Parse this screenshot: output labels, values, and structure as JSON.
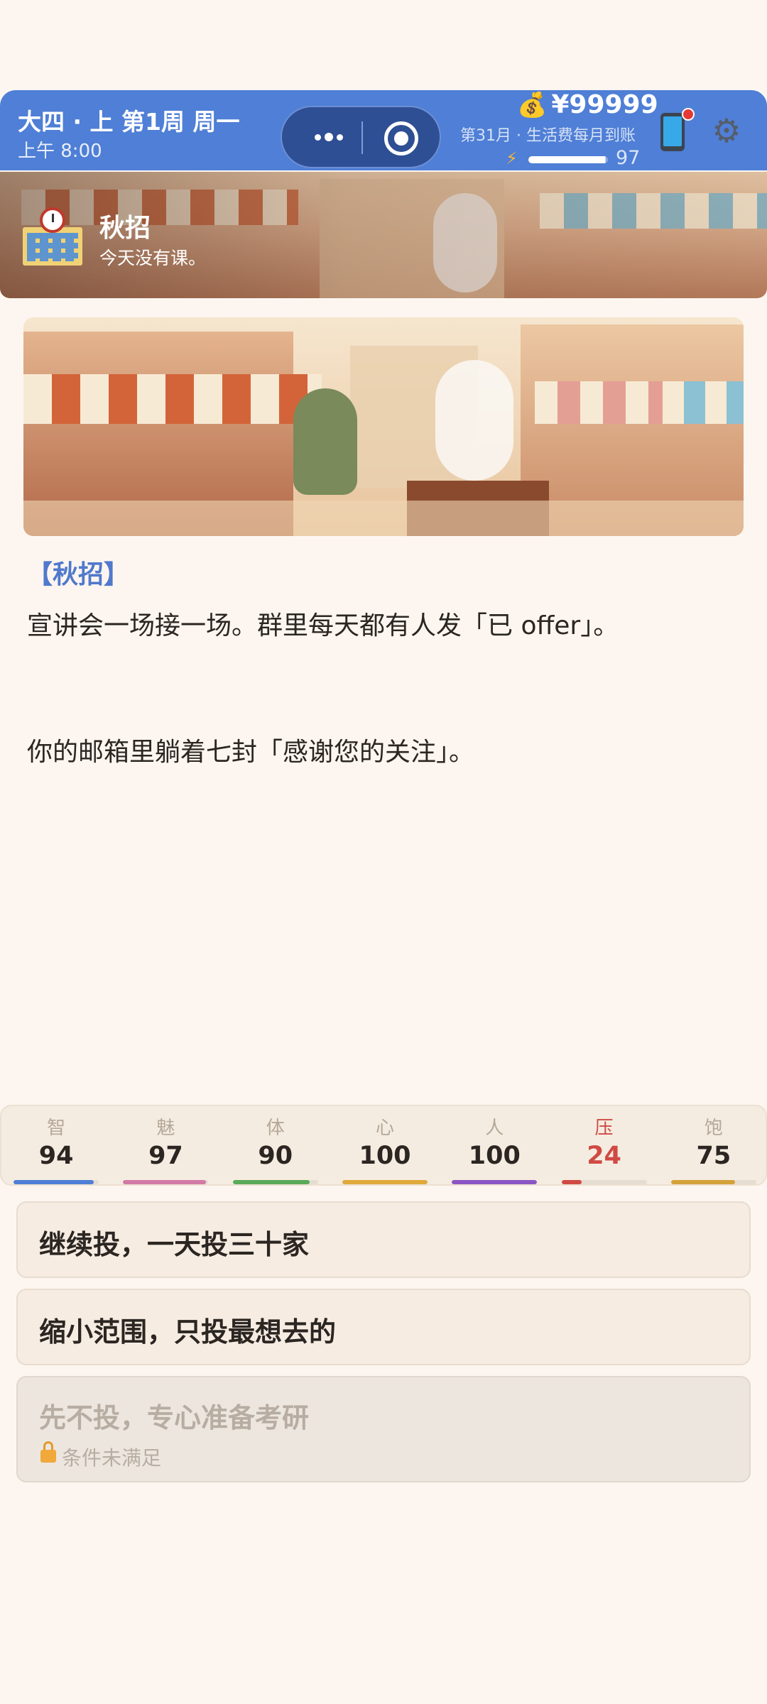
{
  "header": {
    "date_title": "大四 · 上 第1周 周一",
    "time": "上午 8:00",
    "money": "¥99999",
    "allowance_note": "第31月 · 生活费每月到账",
    "energy": 97,
    "energy_max": 100,
    "icons": [
      "more-dots-icon",
      "close-circle-icon",
      "money-bag-icon",
      "lightning-icon",
      "phone-icon",
      "gear-icon"
    ]
  },
  "banner": {
    "title": "秋招",
    "subtitle": "今天没有课。",
    "icon": "school-building-icon"
  },
  "story": {
    "tag": "【秋招】",
    "line1": "宣讲会一场接一场。群里每天都有人发「已 offer」。",
    "line2": "你的邮箱里躺着七封「感谢您的关注」。"
  },
  "stats": [
    {
      "label": "智",
      "value": "94",
      "level": 0.94,
      "color": "#4f7fd6"
    },
    {
      "label": "魅",
      "value": "97",
      "level": 0.97,
      "color": "#d27aa6"
    },
    {
      "label": "体",
      "value": "90",
      "level": 0.9,
      "color": "#5aaa5a"
    },
    {
      "label": "心",
      "value": "100",
      "level": 1.0,
      "color": "#e0a93a"
    },
    {
      "label": "人",
      "value": "100",
      "level": 1.0,
      "color": "#8a55c4"
    },
    {
      "label": "压",
      "value": "24",
      "level": 0.24,
      "color": "#d04a44",
      "warning": true
    },
    {
      "label": "饱",
      "value": "75",
      "level": 0.75,
      "color": "#d4a23a"
    }
  ],
  "choices": [
    {
      "text": "继续投，一天投三十家",
      "enabled": true
    },
    {
      "text": "缩小范围，只投最想去的",
      "enabled": true
    },
    {
      "text": "先不投，专心准备考研",
      "enabled": false,
      "condition": "条件未满足"
    }
  ]
}
